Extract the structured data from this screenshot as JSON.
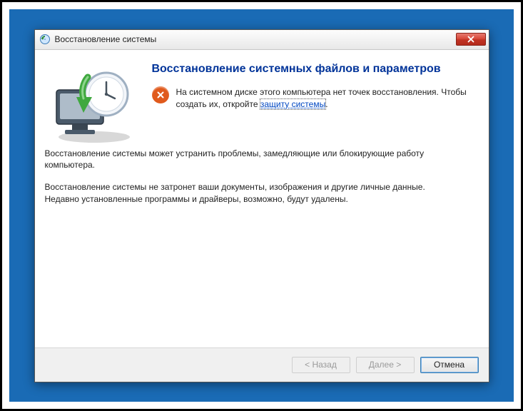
{
  "titlebar": {
    "title": "Восстановление системы"
  },
  "content": {
    "heading": "Восстановление системных файлов и параметров",
    "error_pre": "На системном диске этого компьютера нет точек восстановления. Чтобы создать их, откройте ",
    "error_link": "защиту системы",
    "error_post": ".",
    "para1": "Восстановление системы может устранить проблемы, замедляющие или блокирующие работу компьютера.",
    "para2": "Восстановление системы не затронет ваши документы, изображения и другие личные данные. Недавно установленные программы и драйверы, возможно, будут удалены."
  },
  "buttons": {
    "back": "< Назад",
    "next": "Далее >",
    "cancel": "Отмена"
  }
}
